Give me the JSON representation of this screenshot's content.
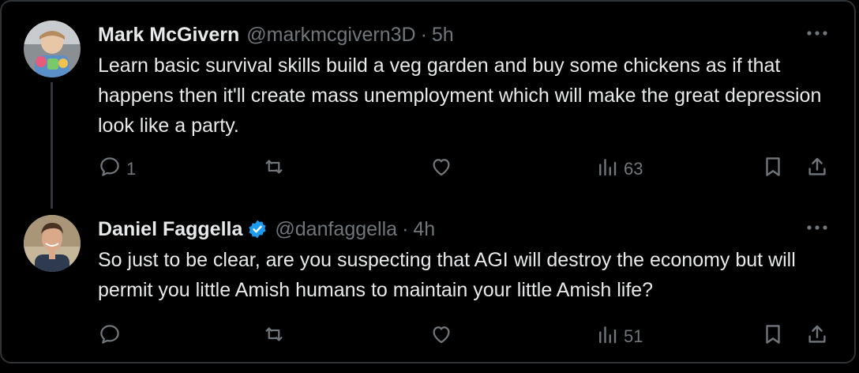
{
  "tweets": [
    {
      "author_name": "Mark McGivern",
      "handle": "@markmcgivern3D",
      "separator": "·",
      "time": "5h",
      "verified": false,
      "text": "Learn basic survival skills build a veg garden and buy some chickens as if that happens then it'll create mass unemployment which will make the great depression look like a party.",
      "reply_count": "1",
      "retweet_count": "",
      "like_count": "",
      "view_count": "63",
      "icons": [
        "reply-icon",
        "retweet-icon",
        "like-icon",
        "views-icon",
        "bookmark-icon",
        "share-icon",
        "more-icon"
      ]
    },
    {
      "author_name": "Daniel Faggella",
      "handle": "@danfaggella",
      "separator": "·",
      "time": "4h",
      "verified": true,
      "text": "So just to be clear, are you suspecting that AGI will destroy the economy but will permit you little Amish humans to maintain your little Amish life?",
      "reply_count": "",
      "retweet_count": "",
      "like_count": "",
      "view_count": "51",
      "icons": [
        "reply-icon",
        "retweet-icon",
        "like-icon",
        "views-icon",
        "bookmark-icon",
        "share-icon",
        "more-icon",
        "verified-badge-icon"
      ]
    }
  ],
  "colors": {
    "background": "#000000",
    "text": "#e7e9ea",
    "muted": "#71767b",
    "border": "#2f3336",
    "verified": "#1d9bf0"
  }
}
